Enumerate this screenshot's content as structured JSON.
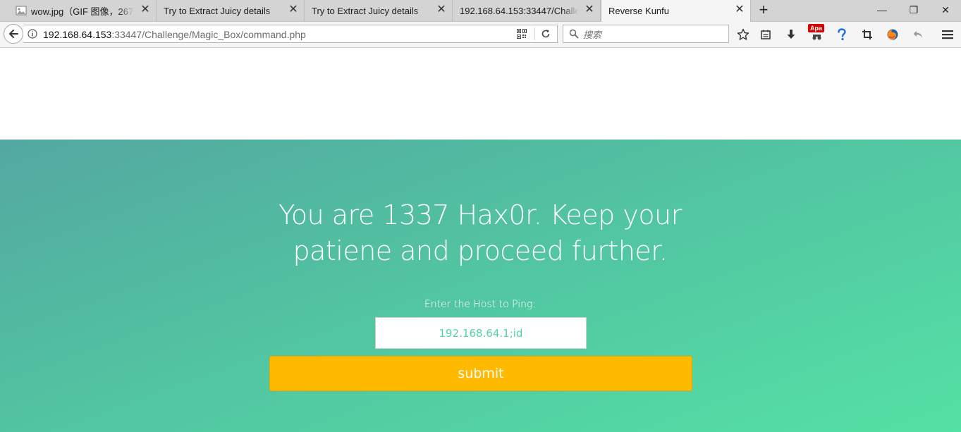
{
  "browser": {
    "tabs": [
      {
        "label": "wow.jpg（GIF 图像，267x",
        "icon": "image-file-icon",
        "active": false
      },
      {
        "label": "Try to Extract Juicy details",
        "active": false
      },
      {
        "label": "Try to Extract Juicy details",
        "active": false
      },
      {
        "label": "192.168.64.153:33447/Challen",
        "active": false
      },
      {
        "label": "Reverse Kunfu",
        "active": true
      }
    ],
    "tab_close_glyph": "✕",
    "new_tab_glyph": "+",
    "window": {
      "minimize": "—",
      "restore": "❐",
      "close": "✕"
    },
    "url": {
      "host": "192.168.64.153",
      "rest": ":33447/Challenge/Magic_Box/command.php"
    },
    "search": {
      "placeholder": "搜索"
    },
    "addon_badge": "Apa",
    "toolbar_icons": [
      "star-icon",
      "reading-list-icon",
      "download-icon",
      "addon-icon",
      "help-icon",
      "crop-icon",
      "firefox-icon",
      "undo-icon",
      "menu-icon"
    ]
  },
  "page": {
    "headline": "You are 1337 Hax0r. Keep your patiene and proceed further.",
    "ping_label": "Enter the Host to Ping:",
    "host_value": "192.168.64.1;id",
    "submit_label": "submit",
    "colors": {
      "gradient_start": "#53a8a1",
      "gradient_end": "#54e1a5",
      "button": "#ffba00",
      "input_text": "#53d3a5"
    }
  }
}
